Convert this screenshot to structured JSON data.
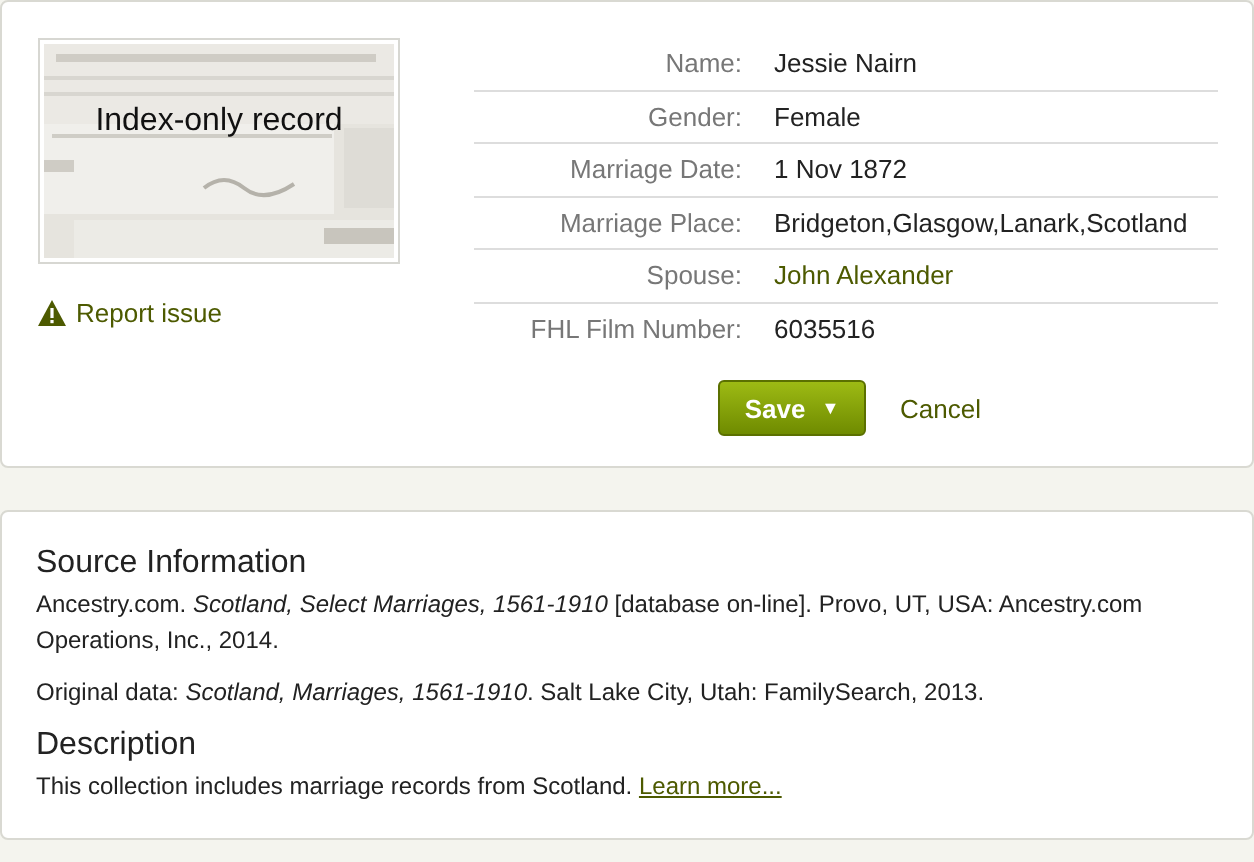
{
  "record": {
    "image": {
      "kind": "picture",
      "caption": "Index-only record"
    },
    "report_link": "Report issue",
    "fields": [
      {
        "label": "Name:",
        "value": "Jessie Nairn",
        "kind": "text"
      },
      {
        "label": "Gender:",
        "value": "Female",
        "kind": "text"
      },
      {
        "label": "Marriage Date:",
        "value": "1 Nov 1872",
        "kind": "text"
      },
      {
        "label": "Marriage Place:",
        "value": "Bridgeton,Glasgow,Lanark,Scotland",
        "kind": "text"
      },
      {
        "label": "Spouse:",
        "value": "John Alexander",
        "kind": "link"
      },
      {
        "label": "FHL Film Number:",
        "value": "6035516",
        "kind": "text"
      }
    ],
    "save_button": {
      "label": "Save",
      "caret": "▼"
    },
    "cancel_link": "Cancel"
  },
  "source": {
    "heading": "Source Information",
    "paragraphs": [
      "Ancestry.com. *Scotland, Select Marriages, 1561-1910* [database on-line]. Provo, UT, USA: Ancestry.com Operations, Inc., 2014.",
      "Original data: *Scotland, Marriages, 1561-1910*. Salt Lake City, Utah: FamilySearch, 2013."
    ],
    "description_heading": "Description",
    "description": "This collection includes marriage records from Scotland.",
    "learn_more": "Learn more..."
  }
}
